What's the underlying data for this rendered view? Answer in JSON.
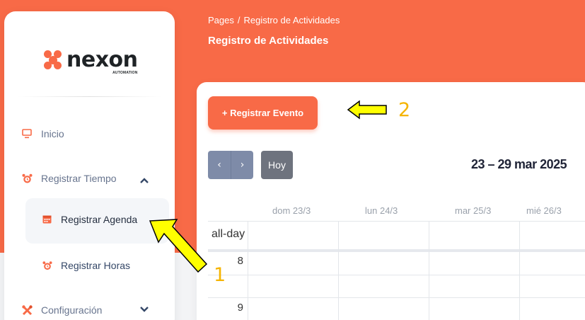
{
  "brand": {
    "name": "nexon",
    "tagline": "AUTOMATION"
  },
  "colors": {
    "accent": "#f86a47",
    "annotation_arrow": "#ffff00",
    "annotation_number": "#f5b400"
  },
  "sidebar": {
    "items": [
      {
        "label": "Inicio",
        "icon": "monitor-icon"
      },
      {
        "label": "Registrar Tiempo",
        "icon": "alarm-clock-icon",
        "expanded": true
      },
      {
        "label": "Registrar Agenda",
        "icon": "calendar-icon",
        "active": true
      },
      {
        "label": "Registrar Horas",
        "icon": "alarm-clock-icon"
      },
      {
        "label": "Configuración",
        "icon": "tools-icon",
        "expanded": false
      }
    ]
  },
  "header": {
    "breadcrumb_root": "Pages",
    "breadcrumb_separator": "/",
    "breadcrumb_current": "Registro de Actividades",
    "title": "Registro de Actividades"
  },
  "toolbar": {
    "register_label": "+ Registrar Evento",
    "prev_label": "‹",
    "next_label": "›",
    "today_label": "Hoy",
    "date_range": "23 – 29 mar 2025"
  },
  "calendar": {
    "days": [
      "dom 23/3",
      "lun 24/3",
      "mar 25/3",
      "mié 26/3"
    ],
    "allday_label": "all-day",
    "hours": [
      "8",
      "9"
    ]
  },
  "annotations": {
    "one": "1",
    "two": "2"
  }
}
